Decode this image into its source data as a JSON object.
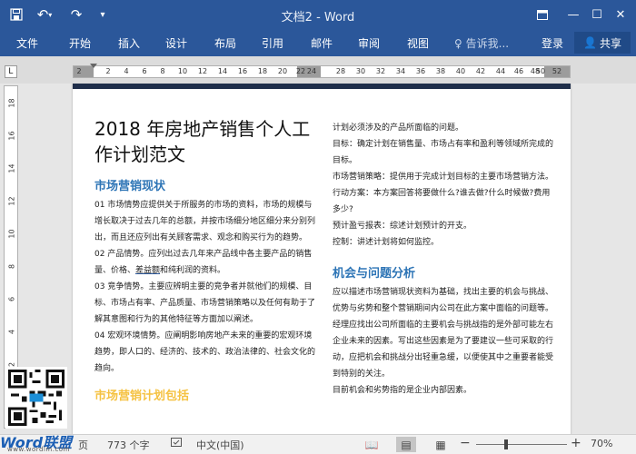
{
  "titlebar": {
    "title": "文档2 - Word",
    "save_icon": "save-icon",
    "undo_icon": "undo-icon",
    "redo_icon": "redo-icon",
    "customize_icon": "chevron-down-icon"
  },
  "ribbon": {
    "tabs": [
      "文件",
      "开始",
      "插入",
      "设计",
      "布局",
      "引用",
      "邮件",
      "审阅",
      "视图"
    ],
    "tell_me": "告诉我...",
    "login": "登录",
    "share": "共享"
  },
  "ruler": {
    "corner": "L",
    "ticks": [
      "2",
      "2",
      "4",
      "6",
      "8",
      "10",
      "12",
      "14",
      "16",
      "18",
      "20",
      "22",
      "24",
      "28",
      "30",
      "32",
      "34",
      "36",
      "38",
      "40",
      "42",
      "44",
      "46",
      "48",
      "50",
      "52"
    ],
    "vticks": [
      "18",
      "16",
      "14",
      "12",
      "10",
      "8",
      "6",
      "4",
      "2",
      "2"
    ]
  },
  "document": {
    "title": "2018 年房地产销售个人工作计划范文",
    "left": {
      "h1": "市场营销现状",
      "p1": "01 市场情势应提供关于所服务的市场的资料，市场的规模与增长取决于过去几年的总额，并按市场细分地区细分来分别列出，而且还应列出有关顾客需求、观念和购买行为的趋势。",
      "p2a": "02 产品情势。应列出过去几年来产品线中各主要产品的销售量、价格、",
      "p2u": "差益额",
      "p2b": "和纯利润的资料。",
      "p3": "03 竞争情势。主要应辨明主要的竞争者并就他们的规模、目标、市场占有率、产品质量、市场营销策略以及任何有助于了解其意图和行为的其他特征等方面加以阐述。",
      "p4": "04 宏观环境情势。应阐明影响房地产未来的重要的宏观环境趋势，即人口的、经济的、技术的、政治法律的、社会文化的趋向。",
      "h2": "市场营销计划包括"
    },
    "right": {
      "r1": "计划必须涉及的产品所面临的问题。",
      "r2": "目标：确定计划在销售量、市场占有率和盈利等领域所完成的目标。",
      "r3": "市场营销策略：提供用于完成计划目标的主要市场营销方法。",
      "r4": "行动方案：本方案回答将要做什么?谁去做?什么时候做?费用多少?",
      "r5": "预计盈亏报表：综述计划预计的开支。",
      "r6": "控制：讲述计划将如何监控。",
      "h": "机会与问题分析",
      "r7": "应以描述市场营销现状资料为基础，找出主要的机会与挑战、优势与劣势和整个营销期间内公司在此方案中面临的问题等。",
      "r8": "经理应找出公司所面临的主要机会与挑战指的是外部可能左右企业未来的因素。写出这些因素是为了要建议一些可采取的行动，应把机会和挑战分出轻重急缓，以便使其中之重要者能受到特别的关注。",
      "r9": "目前机会和劣势指的是企业内部因素。"
    }
  },
  "status": {
    "page": "页",
    "words": "773 个字",
    "proof_icon": "proofing-icon",
    "language": "中文(中国)",
    "zoom": "70%",
    "zoom_level": 0.7,
    "watermark": "Word联盟",
    "watermark_url": "www.wordlm.com"
  },
  "colors": {
    "brand": "#2b579a",
    "heading": "#2e75b6"
  }
}
